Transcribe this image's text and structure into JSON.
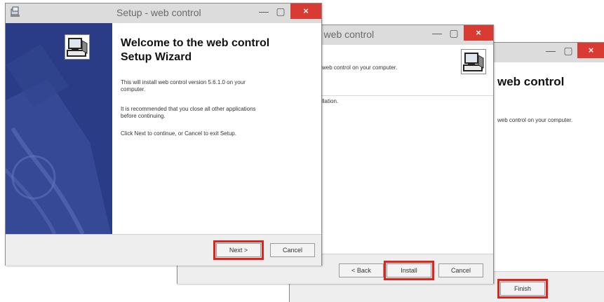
{
  "window1": {
    "title": "Setup - web control",
    "close_glyph": "×",
    "minimize_glyph": "—",
    "maximize_glyph": "▢",
    "heading_line1": "Welcome to the web control",
    "heading_line2": "Setup Wizard",
    "para1_line1": "This will install web control version 5.6.1.0 on your",
    "para1_line2": "computer.",
    "para2_line1": "It is recommended that you close all other applications",
    "para2_line2": "before continuing.",
    "para3": "Click Next to continue, or Cancel to exit Setup.",
    "next_label": "Next >",
    "cancel_label": "Cancel"
  },
  "window2": {
    "title": "- web control",
    "close_glyph": "×",
    "minimize_glyph": "—",
    "maximize_glyph": "▢",
    "line1": "web control on your computer.",
    "line2": "llation.",
    "back_label": "< Back",
    "install_label": "Install",
    "cancel_label": "Cancel"
  },
  "window3": {
    "close_glyph": "×",
    "minimize_glyph": "—",
    "maximize_glyph": "▢",
    "heading": "web control",
    "line1": "web control on your computer.",
    "finish_label": "Finish"
  },
  "colors": {
    "highlight": "#e0231b",
    "sidebar": "#2a3c86",
    "close": "#d93a32"
  }
}
